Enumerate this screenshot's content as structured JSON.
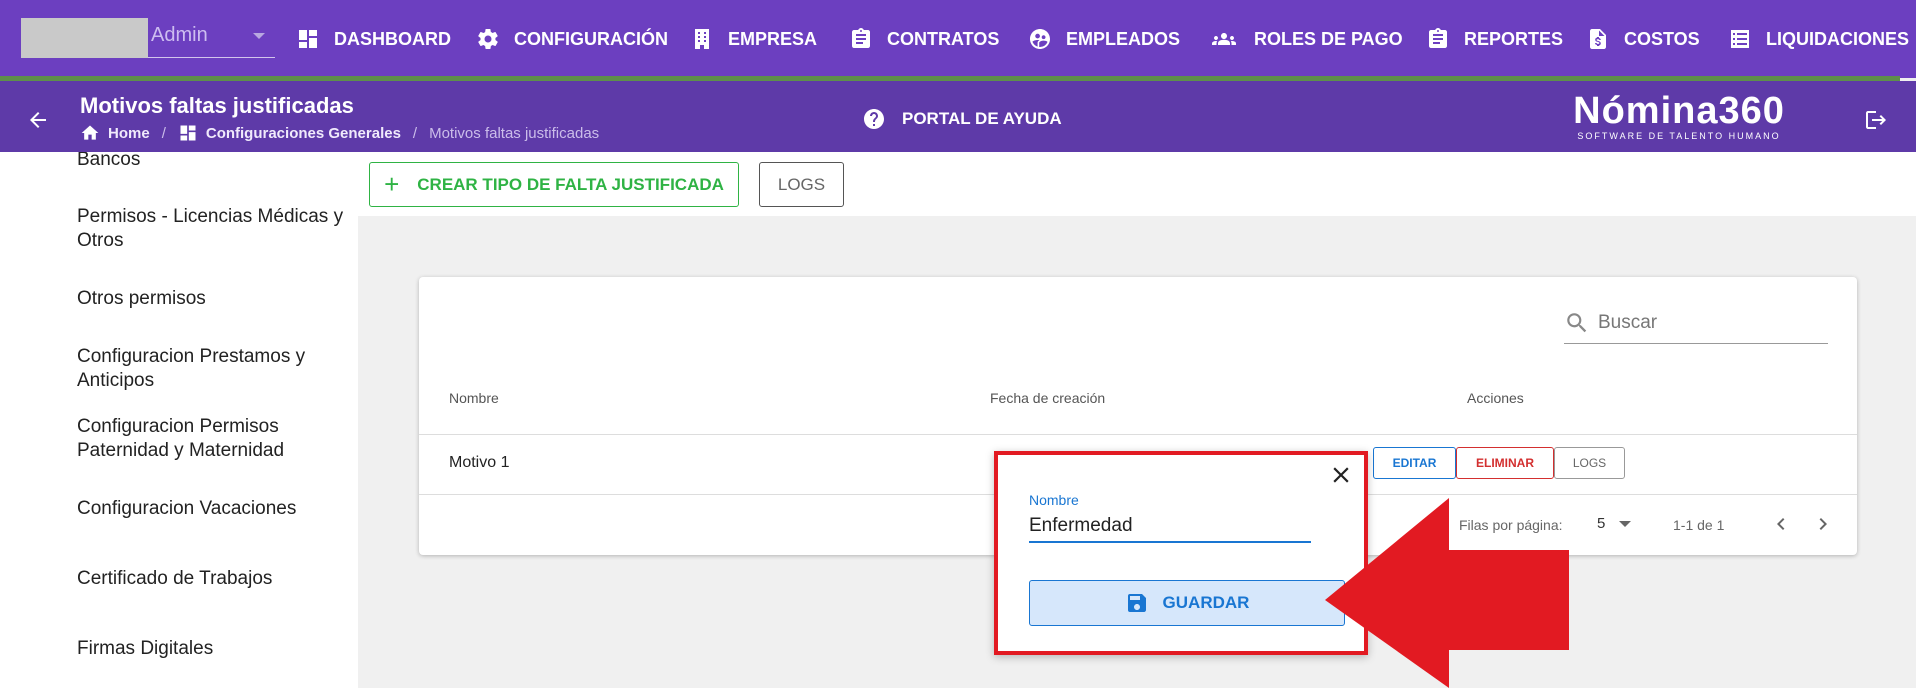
{
  "topbar": {
    "user_name": "Admin",
    "nav": [
      {
        "label": "DASHBOARD",
        "icon": "dashboard-icon"
      },
      {
        "label": "CONFIGURACIÓN",
        "icon": "gear-icon"
      },
      {
        "label": "EMPRESA",
        "icon": "building-icon"
      },
      {
        "label": "CONTRATOS",
        "icon": "clipboard-icon"
      },
      {
        "label": "EMPLEADOS",
        "icon": "people-circle-icon"
      },
      {
        "label": "ROLES DE PAGO",
        "icon": "group-icon"
      },
      {
        "label": "REPORTES",
        "icon": "clipboard-icon"
      },
      {
        "label": "COSTOS",
        "icon": "dollar-file-icon"
      },
      {
        "label": "LIQUIDACIONES",
        "icon": "list-icon"
      }
    ]
  },
  "subheader": {
    "title": "Motivos faltas justificadas",
    "breadcrumb": {
      "home": "Home",
      "section": "Configuraciones Generales",
      "current": "Motivos faltas justificadas"
    },
    "help_label": "PORTAL DE AYUDA",
    "brand_logo": "Nómina360",
    "brand_tagline": "SOFTWARE DE TALENTO HUMANO"
  },
  "sidebar": {
    "items": [
      "Bancos",
      "Permisos - Licencias Médicas y Otros",
      "Otros permisos",
      "Configuracion Prestamos y Anticipos",
      "Configuracion Permisos Paternidad y Maternidad",
      "Configuracion Vacaciones",
      "Certificado de Trabajos",
      "Firmas Digitales"
    ]
  },
  "actions": {
    "create_label": "CREAR TIPO DE FALTA JUSTIFICADA",
    "logs_label": "LOGS"
  },
  "table": {
    "search_placeholder": "Buscar",
    "columns": [
      "Nombre",
      "Fecha de creación",
      "Acciones"
    ],
    "rows": [
      {
        "nombre": "Motivo 1",
        "fecha": ""
      }
    ],
    "row_actions": {
      "edit": "EDITAR",
      "delete": "ELIMINAR",
      "logs": "LOGS"
    },
    "pagination": {
      "rows_per_page_label": "Filas por página:",
      "rows_per_page": "5",
      "range": "1-1 de 1"
    }
  },
  "dialog": {
    "field_label": "Nombre",
    "field_value": "Enfermedad",
    "save_label": "GUARDAR"
  },
  "colors": {
    "primary_purple": "#6c3fc0",
    "header_purple": "#5e3aa8",
    "success_green": "#2fb344",
    "info_blue": "#1976d2",
    "danger_red": "#d32f2f",
    "highlight_red": "#e21a22"
  }
}
